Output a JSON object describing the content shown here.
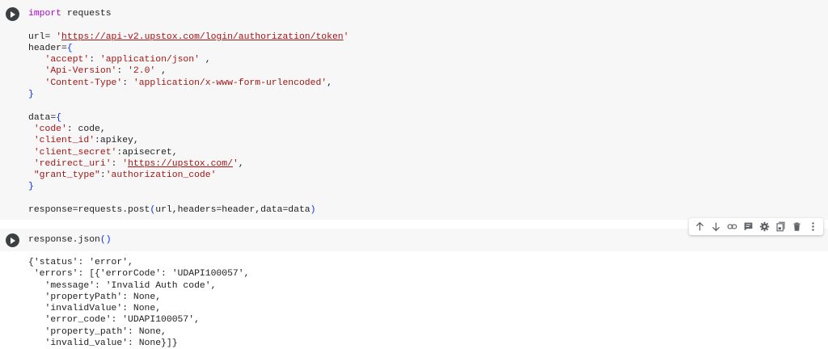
{
  "cell1": {
    "lines": [
      [
        {
          "t": "kw",
          "v": "import"
        },
        {
          "t": "pln",
          "v": " requests"
        }
      ],
      [],
      [
        {
          "t": "pln",
          "v": "url= "
        },
        {
          "t": "str",
          "v": "'"
        },
        {
          "t": "url",
          "v": "https://api-v2.upstox.com/login/authorization/token"
        },
        {
          "t": "str",
          "v": "'"
        }
      ],
      [
        {
          "t": "pln",
          "v": "header="
        },
        {
          "t": "brace",
          "v": "{"
        }
      ],
      [
        {
          "t": "pln",
          "v": "   "
        },
        {
          "t": "str",
          "v": "'accept'"
        },
        {
          "t": "pln",
          "v": ": "
        },
        {
          "t": "str",
          "v": "'application/json'"
        },
        {
          "t": "pln",
          "v": " ,"
        }
      ],
      [
        {
          "t": "pln",
          "v": "   "
        },
        {
          "t": "str",
          "v": "'Api-Version'"
        },
        {
          "t": "pln",
          "v": ": "
        },
        {
          "t": "str",
          "v": "'2.0'"
        },
        {
          "t": "pln",
          "v": " ,"
        }
      ],
      [
        {
          "t": "pln",
          "v": "   "
        },
        {
          "t": "str",
          "v": "'Content-Type'"
        },
        {
          "t": "pln",
          "v": ": "
        },
        {
          "t": "str",
          "v": "'application/x-www-form-urlencoded'"
        },
        {
          "t": "pln",
          "v": ","
        }
      ],
      [
        {
          "t": "brace",
          "v": "}"
        }
      ],
      [],
      [
        {
          "t": "pln",
          "v": "data="
        },
        {
          "t": "brace",
          "v": "{"
        }
      ],
      [
        {
          "t": "pln",
          "v": " "
        },
        {
          "t": "str",
          "v": "'code'"
        },
        {
          "t": "pln",
          "v": ": code,"
        }
      ],
      [
        {
          "t": "pln",
          "v": " "
        },
        {
          "t": "str",
          "v": "'client_id'"
        },
        {
          "t": "pln",
          "v": ":apikey,"
        }
      ],
      [
        {
          "t": "pln",
          "v": " "
        },
        {
          "t": "str",
          "v": "'client_secret'"
        },
        {
          "t": "pln",
          "v": ":apisecret,"
        }
      ],
      [
        {
          "t": "pln",
          "v": " "
        },
        {
          "t": "str",
          "v": "'redirect_uri'"
        },
        {
          "t": "pln",
          "v": ": "
        },
        {
          "t": "str",
          "v": "'"
        },
        {
          "t": "url",
          "v": "https://upstox.com/"
        },
        {
          "t": "str",
          "v": "'"
        },
        {
          "t": "pln",
          "v": ","
        }
      ],
      [
        {
          "t": "pln",
          "v": " "
        },
        {
          "t": "str",
          "v": "\"grant_type\""
        },
        {
          "t": "pln",
          "v": ":"
        },
        {
          "t": "str",
          "v": "'authorization_code'"
        }
      ],
      [
        {
          "t": "brace",
          "v": "}"
        }
      ],
      [],
      [
        {
          "t": "pln",
          "v": "response=requests.post"
        },
        {
          "t": "brace",
          "v": "("
        },
        {
          "t": "pln",
          "v": "url,headers=header,data=data"
        },
        {
          "t": "brace",
          "v": ")"
        }
      ]
    ]
  },
  "cell2": {
    "lines": [
      [
        {
          "t": "pln",
          "v": "response.json"
        },
        {
          "t": "brace",
          "v": "("
        },
        {
          "t": "brace",
          "v": ")"
        }
      ]
    ]
  },
  "output": {
    "text": "{'status': 'error',\n 'errors': [{'errorCode': 'UDAPI100057',\n   'message': 'Invalid Auth code',\n   'propertyPath': None,\n   'invalidValue': None,\n   'error_code': 'UDAPI100057',\n   'property_path': None,\n   'invalid_value': None}]}"
  },
  "toolbar": {
    "buttons": [
      "arrow-up-icon",
      "arrow-down-icon",
      "link-icon",
      "comment-icon",
      "gear-icon",
      "mirror-cell-icon",
      "trash-icon",
      "more-vert-icon"
    ]
  }
}
